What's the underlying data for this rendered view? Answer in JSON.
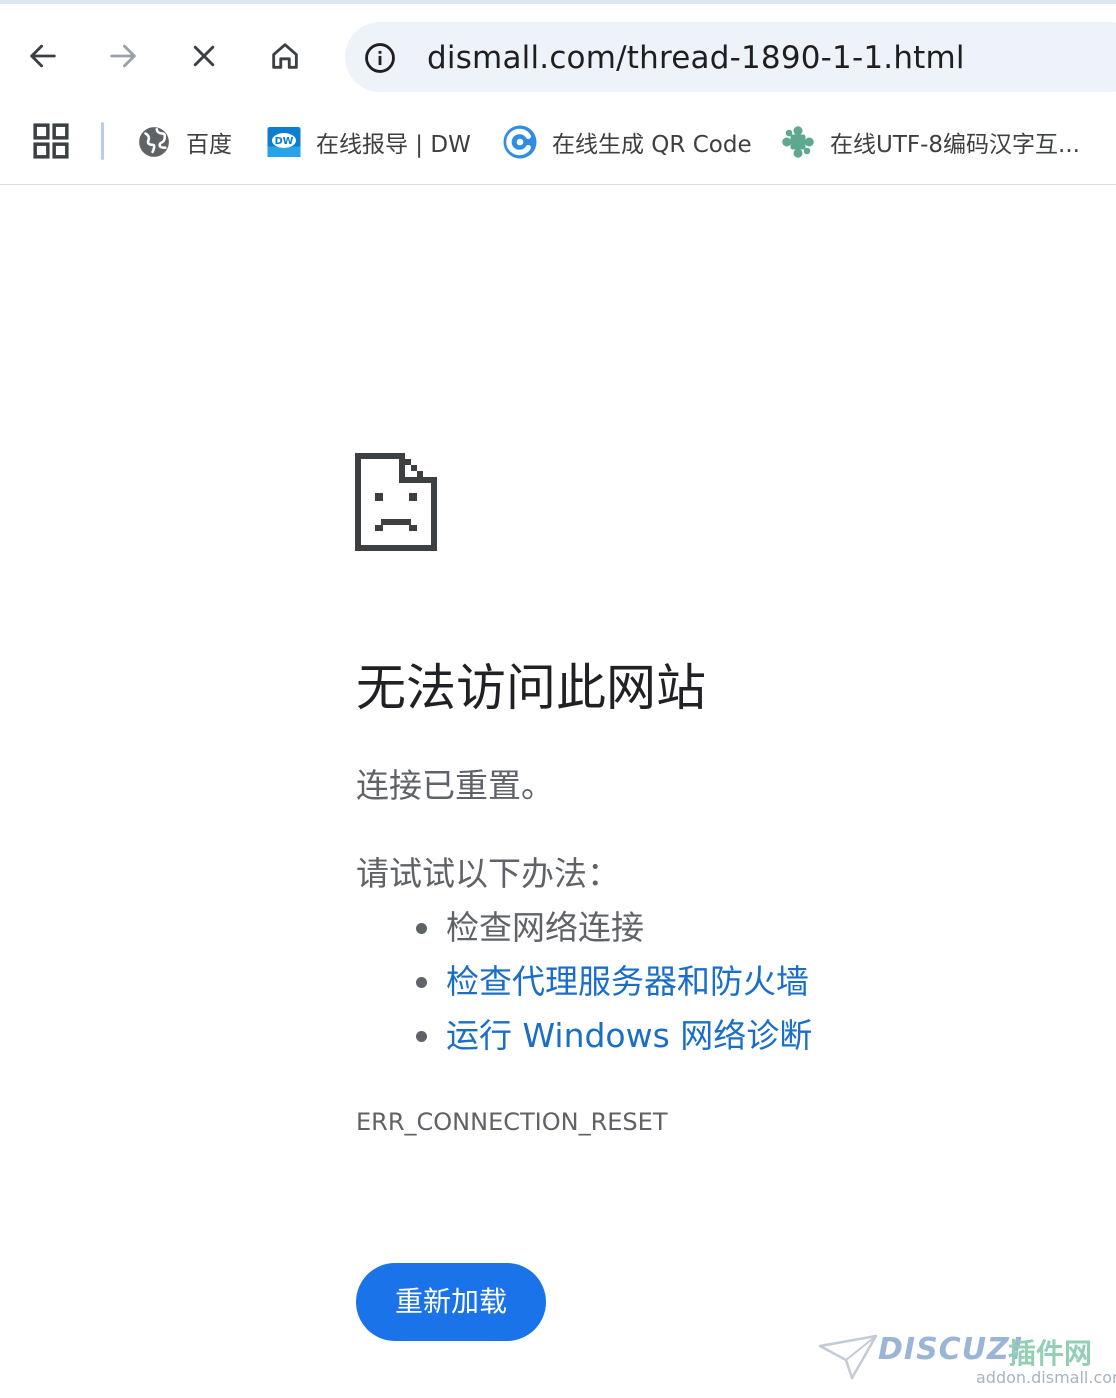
{
  "browser": {
    "nav": {
      "back_icon": "arrow-left-icon",
      "forward_icon": "arrow-right-icon",
      "stop_icon": "close-icon",
      "home_icon": "home-icon"
    },
    "omnibox": {
      "url": "dismall.com/thread-1890-1-1.html",
      "icon": "info-icon"
    },
    "bookmarks": [
      {
        "label": "百度",
        "icon": "globe-icon"
      },
      {
        "label": "在线报导 | DW",
        "icon": "dw-icon"
      },
      {
        "label": "在线生成 QR Code",
        "icon": "qr-c-icon"
      },
      {
        "label": "在线UTF-8编码汉字互...",
        "icon": "puzzle-icon"
      }
    ]
  },
  "error_page": {
    "icon": "sad-document-icon",
    "title": "无法访问此网站",
    "message": "连接已重置。",
    "try_label": "请试试以下办法：",
    "suggestions": [
      {
        "text": "检查网络连接",
        "is_link": false
      },
      {
        "text": "检查代理服务器和防火墙",
        "is_link": true
      },
      {
        "text": "运行 Windows 网络诊断",
        "is_link": true
      }
    ],
    "error_code": "ERR_CONNECTION_RESET",
    "reload_label": "重新加载"
  },
  "watermark": {
    "brand": "DISCUZ!",
    "brand_cn": "插件网",
    "domain": "addon.dismall.com"
  },
  "colors": {
    "accent": "#1a73e8",
    "link": "#1a6ec7",
    "text_secondary": "#5f6368",
    "omnibox_bg": "#eef2f9"
  }
}
